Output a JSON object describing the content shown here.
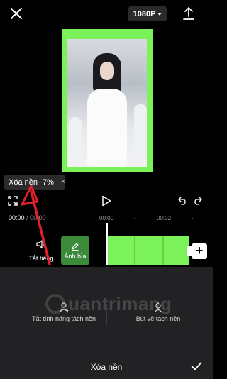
{
  "topbar": {
    "close_icon": "close-icon",
    "resolution_label": "1080P",
    "export_icon": "upload-icon"
  },
  "tooltip": {
    "label": "Xóa nền",
    "progress": "7%",
    "close_label": "×"
  },
  "playback": {
    "current_time": "00:00",
    "duration": "00:00",
    "ruler_labels": [
      "00:00",
      "00:02"
    ],
    "icons": [
      "fullscreen-icon",
      "play-icon",
      "undo-icon",
      "redo-icon"
    ]
  },
  "timeline": {
    "mute_label": "Tắt tiếng",
    "cover_label": "Ảnh bìa",
    "add_label": "+",
    "clip_color": "#7cf25a"
  },
  "panel": {
    "option_left": "Tắt tính năng tách nền",
    "option_right": "Bút vẽ tách nền",
    "watermark": "uantrimang"
  },
  "footer": {
    "title": "Xóa nền",
    "confirm_icon": "check-icon"
  },
  "colors": {
    "green_screen": "#7cf25a",
    "annotation_arrow": "#e0202b"
  }
}
